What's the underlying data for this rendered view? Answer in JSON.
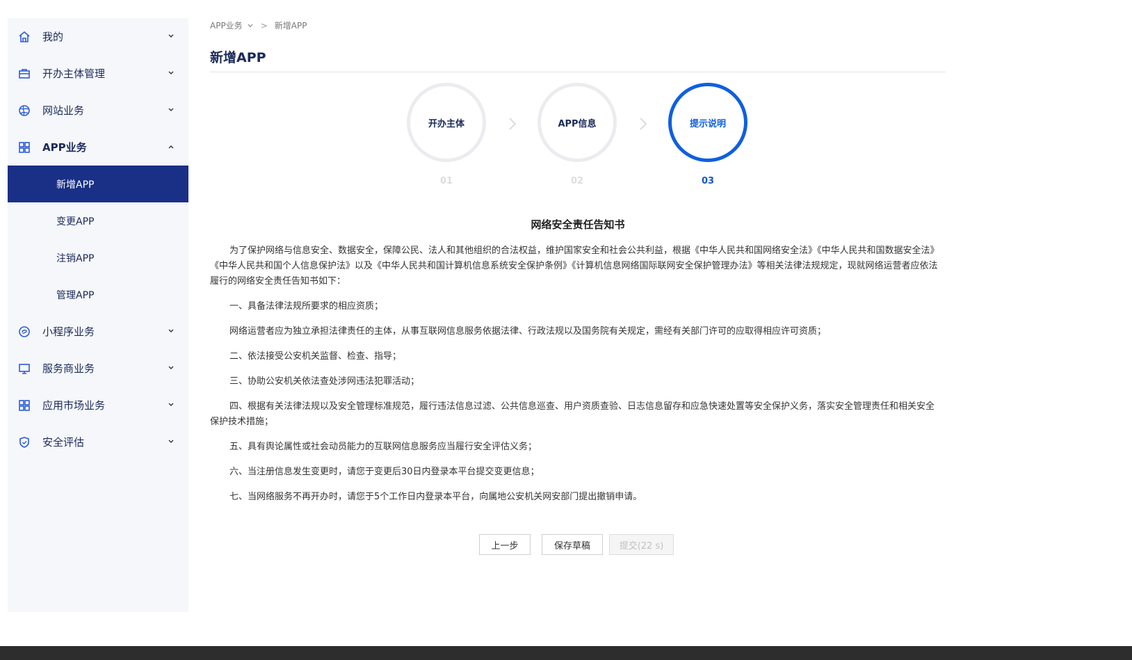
{
  "sidebar": {
    "items": [
      {
        "label": "我的",
        "icon": "home-icon"
      },
      {
        "label": "开办主体管理",
        "icon": "briefcase-icon"
      },
      {
        "label": "网站业务",
        "icon": "globe-icon"
      },
      {
        "label": "APP业务",
        "icon": "grid-icon",
        "expanded": true,
        "children": [
          {
            "label": "新增APP",
            "active": true
          },
          {
            "label": "变更APP"
          },
          {
            "label": "注销APP"
          },
          {
            "label": "管理APP"
          }
        ]
      },
      {
        "label": "小程序业务",
        "icon": "mini-program-icon"
      },
      {
        "label": "服务商业务",
        "icon": "monitor-icon"
      },
      {
        "label": "应用市场业务",
        "icon": "grid-icon"
      },
      {
        "label": "安全评估",
        "icon": "shield-icon"
      }
    ]
  },
  "breadcrumb": {
    "parent": "APP业务",
    "separator": ">",
    "current": "新增APP"
  },
  "page": {
    "title": "新增APP"
  },
  "steps": [
    {
      "label": "开办主体",
      "number": "01",
      "current": false
    },
    {
      "label": "APP信息",
      "number": "02",
      "current": false
    },
    {
      "label": "提示说明",
      "number": "03",
      "current": true
    }
  ],
  "notice": {
    "title": "网络安全责任告知书",
    "paragraphs": [
      "为了保护网络与信息安全、数据安全，保障公民、法人和其他组织的合法权益，维护国家安全和社会公共利益，根据《中华人民共和国网络安全法》《中华人民共和国数据安全法》《中华人民共和国个人信息保护法》以及《中华人民共和国计算机信息系统安全保护条例》《计算机信息网络国际联网安全保护管理办法》等相关法律法规规定，现就网络运营者应依法履行的网络安全责任告知书如下：",
      "一、具备法律法规所要求的相应资质；",
      "网络运营者应为独立承担法律责任的主体，从事互联网信息服务依据法律、行政法规以及国务院有关规定，需经有关部门许可的应取得相应许可资质；",
      "二、依法接受公安机关监督、检查、指导；",
      "三、协助公安机关依法查处涉网违法犯罪活动；",
      "四、根据有关法律法规以及安全管理标准规范，履行违法信息过滤、公共信息巡查、用户资质查验、日志信息留存和应急快速处置等安全保护义务，落实安全管理责任和相关安全保护技术措施；",
      "五、具有舆论属性或社会动员能力的互联网信息服务应当履行安全评估义务；",
      "六、当注册信息发生变更时，请您于变更后30日内登录本平台提交变更信息；",
      "七、当网络服务不再开办时，请您于5个工作日内登录本平台，向属地公安机关网安部门提出撤销申请。"
    ]
  },
  "buttons": {
    "prev": "上一步",
    "save_draft": "保存草稿",
    "submit": "提交(22 s)"
  },
  "colors": {
    "primary": "#1a3087",
    "accent": "#0f5fe0",
    "sidebar_bg": "#f5f7fa"
  }
}
